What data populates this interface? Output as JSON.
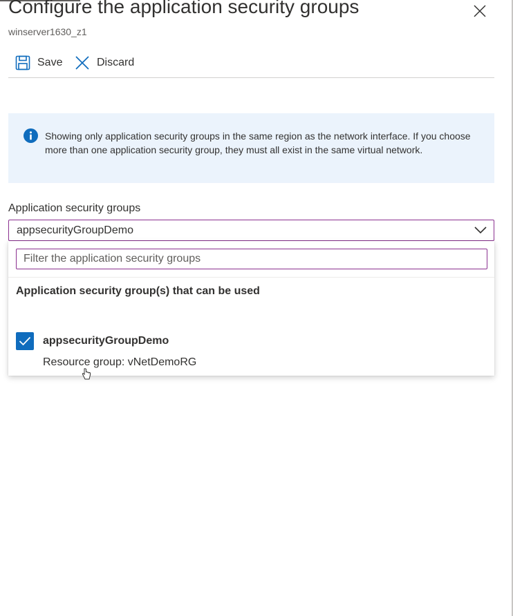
{
  "blade": {
    "title": "Configure the application security groups",
    "subtitle": "winserver1630_z1",
    "close_icon": "close-icon"
  },
  "toolbar": {
    "save_label": "Save",
    "save_icon": "save-icon",
    "discard_label": "Discard",
    "discard_icon": "close-icon"
  },
  "info": {
    "icon": "info-icon",
    "text": "Showing only application security groups in the same region as the network interface. If you choose more than one application security group, they must all exist in the same virtual network."
  },
  "asg_field": {
    "label": "Application security groups",
    "selected_value": "appsecurityGroupDemo",
    "filter_placeholder": "Filter the application security groups",
    "section_heading": "Application security group(s) that can be used",
    "options": [
      {
        "name": "appsecurityGroupDemo",
        "resource_group": "Resource group: vNetDemoRG",
        "checked": true
      }
    ]
  },
  "colors": {
    "accent_blue": "#0f6cbd",
    "focus_border": "#8a2f8f",
    "info_background": "#ebf3fc"
  }
}
